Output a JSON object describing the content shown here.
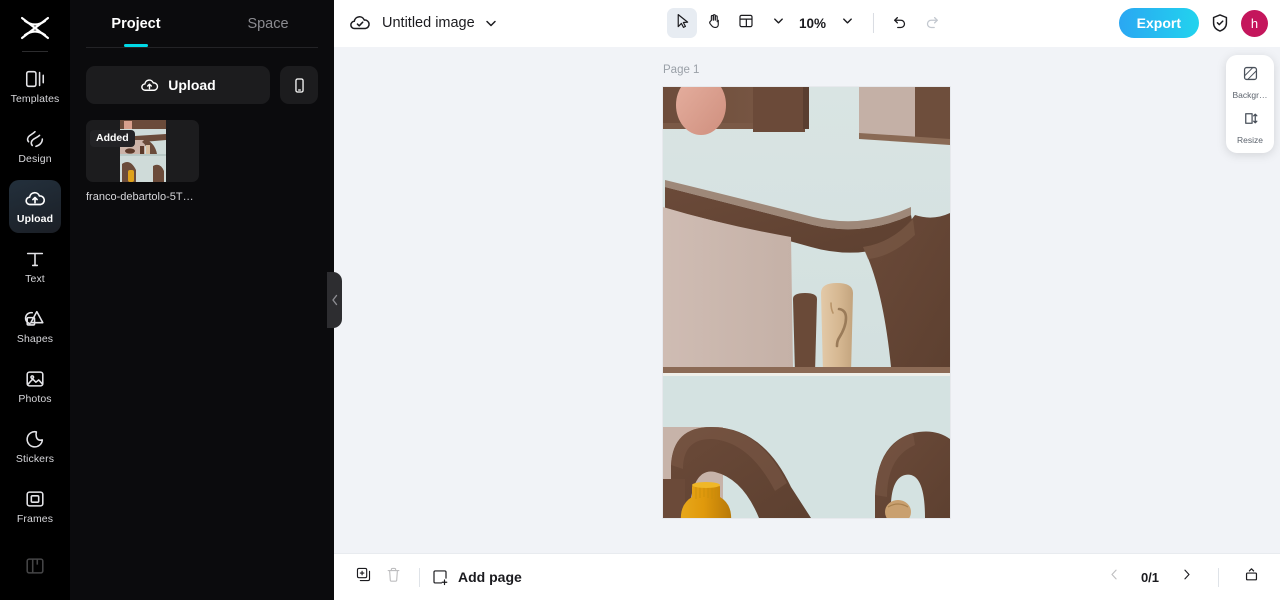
{
  "rail": {
    "logo_icon": "capcut-logo-icon",
    "items": [
      {
        "label": "Templates",
        "icon": "templates-icon",
        "active": false
      },
      {
        "label": "Design",
        "icon": "design-icon",
        "active": false
      },
      {
        "label": "Upload",
        "icon": "upload-cloud-icon",
        "active": true
      },
      {
        "label": "Text",
        "icon": "text-icon",
        "active": false
      },
      {
        "label": "Shapes",
        "icon": "shapes-icon",
        "active": false
      },
      {
        "label": "Photos",
        "icon": "photos-icon",
        "active": false
      },
      {
        "label": "Stickers",
        "icon": "stickers-icon",
        "active": false
      },
      {
        "label": "Frames",
        "icon": "frames-icon",
        "active": false
      }
    ]
  },
  "panel": {
    "tabs": [
      {
        "label": "Project",
        "active": true
      },
      {
        "label": "Space",
        "active": false
      }
    ],
    "upload_label": "Upload",
    "upload_icon": "upload-cloud-icon",
    "mobile_icon": "mobile-phone-icon",
    "assets": [
      {
        "badge": "Added",
        "name": "franco-debartolo-5T…"
      }
    ],
    "collapse_icon": "chevron-left-icon"
  },
  "topbar": {
    "cloud_icon": "cloud-saved-icon",
    "title": "Untitled image",
    "title_caret_icon": "chevron-down-icon",
    "tools": [
      {
        "name": "select-tool",
        "icon": "cursor-arrow-icon",
        "selected": true
      },
      {
        "name": "hand-tool",
        "icon": "hand-icon",
        "selected": false
      },
      {
        "name": "layout-tool",
        "icon": "layout-grid-icon",
        "selected": false
      }
    ],
    "layout_caret_icon": "chevron-down-icon",
    "zoom_value": "10%",
    "zoom_caret_icon": "chevron-down-icon",
    "undo_icon": "undo-arrow-icon",
    "redo_icon": "redo-arrow-icon",
    "export_label": "Export",
    "shield_icon": "shield-check-icon",
    "avatar_initial": "h"
  },
  "canvas": {
    "page_label": "Page 1",
    "background_color": "#f1f3f7",
    "artboard_alt": "photo of sculptural brown and beige vases on pale blue shelving"
  },
  "float_tools": [
    {
      "label": "Backgr…",
      "icon": "background-swatch-icon"
    },
    {
      "label": "Resize",
      "icon": "resize-icon"
    }
  ],
  "bottombar": {
    "duplicate_icon": "duplicate-page-icon",
    "delete_icon": "trash-icon",
    "add_page_icon": "add-page-icon",
    "add_page_label": "Add page",
    "prev_icon": "chevron-left-icon",
    "page_indicator": "0/1",
    "next_icon": "chevron-right-icon",
    "panel_toggle_icon": "panel-expand-icon"
  },
  "colors": {
    "accent_cyan": "#00d9e6",
    "export_gradient_start": "#2aa7f2",
    "export_gradient_end": "#22d3ee",
    "avatar": "#c4165c",
    "rail_bg": "#000000",
    "panel_bg": "#0b0b0d",
    "canvas_bg": "#f1f3f7"
  }
}
